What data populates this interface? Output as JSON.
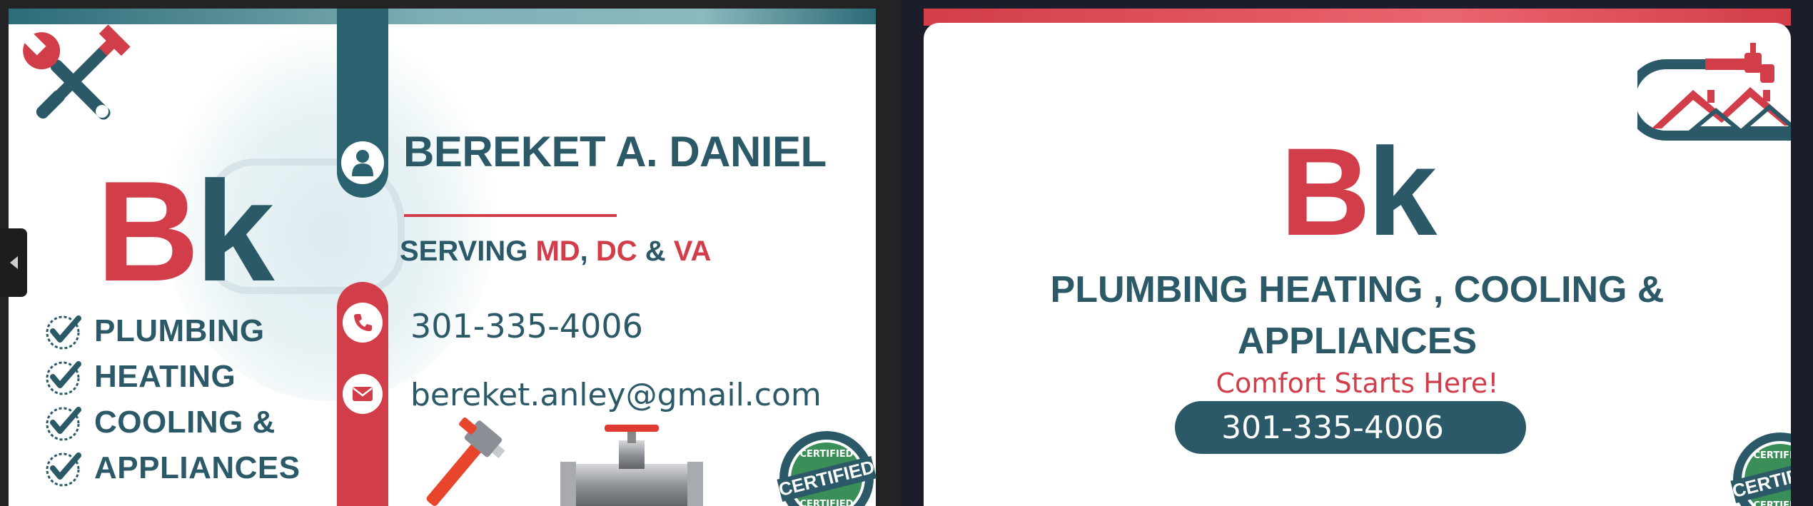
{
  "cards": {
    "front": {
      "logo_b": "B",
      "logo_k": "k",
      "services": [
        "PLUMBING",
        "HEATING",
        "COOLING &",
        "APPLIANCES"
      ],
      "name": "BEREKET  A. DANIEL",
      "serving": {
        "prefix": "SERVING ",
        "md": "MD",
        "sep1": ", ",
        "dc": "DC",
        "amp": " & ",
        "va": "VA"
      },
      "phone": "301-335-4006",
      "email": "bereket.anley@gmail.com",
      "badge": {
        "top": "CERTIFIED",
        "middle": "CERTIFIED",
        "bottom": "CERTIFIED"
      }
    },
    "back": {
      "logo_b": "B",
      "logo_k": "k",
      "services_line1": "PLUMBING HEATING , COOLING &",
      "services_line2": "APPLIANCES",
      "tagline": "Comfort Starts Here!",
      "phone": "301-335-4006",
      "badge": {
        "top": "CERTIFIED",
        "middle": "CERTIFIED",
        "bottom": "CERTIFIED"
      }
    }
  },
  "colors": {
    "red": "#d23d4a",
    "teal": "#2b5968",
    "teal_band": "#2b6270",
    "green_badge": "#2e7d4f",
    "navy_badge": "#2b5968"
  },
  "icons": [
    "tools-icon",
    "person-icon",
    "phone-icon",
    "mail-icon",
    "check-icon",
    "pipe-wrench-icon",
    "valve-icon",
    "house-faucet-icon",
    "certified-badge-icon",
    "chevron-left-icon"
  ]
}
